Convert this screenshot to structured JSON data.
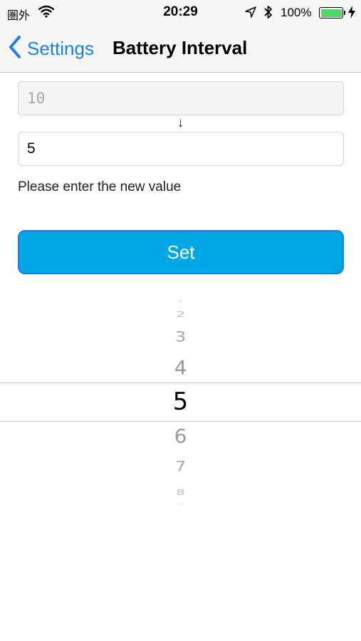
{
  "status_bar": {
    "carrier": "圏外",
    "time": "20:29",
    "battery_percent": "100%",
    "battery_color": "#4cd964"
  },
  "nav": {
    "back_label": "Settings",
    "title": "Battery Interval",
    "tint_color": "#1d7ff2"
  },
  "form": {
    "old_value": "10",
    "arrow": "↓",
    "new_value": "5",
    "hint": "Please enter the new value",
    "set_label": "Set",
    "button_color": "#00a8e6"
  },
  "picker": {
    "items": [
      "1",
      "2",
      "3",
      "4",
      "5",
      "6",
      "7",
      "8",
      "9"
    ],
    "selected": "5"
  }
}
